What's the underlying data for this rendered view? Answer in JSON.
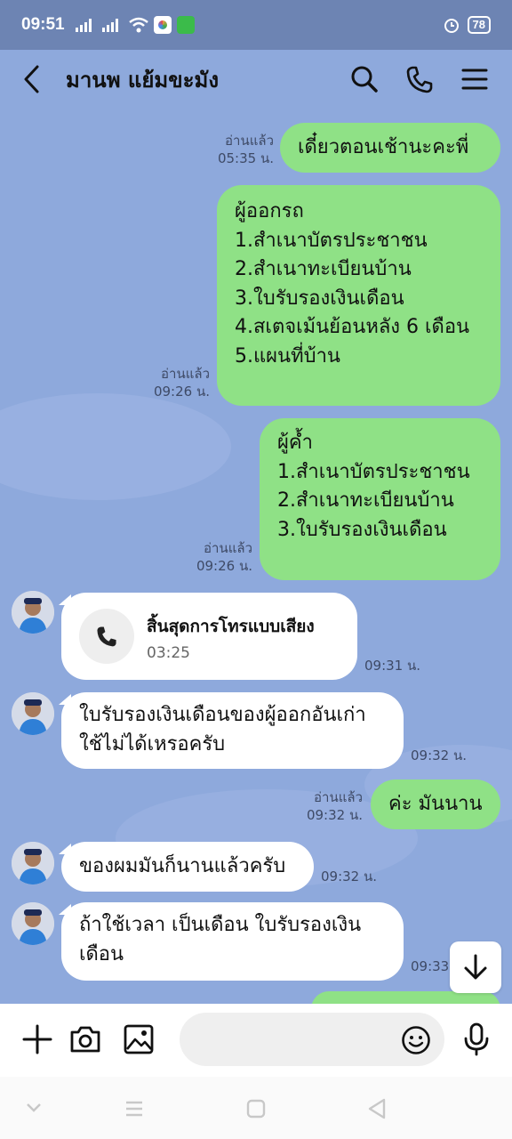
{
  "status": {
    "time": "09:51",
    "battery": "78"
  },
  "header": {
    "title": "มานพ แย้มขะมัง"
  },
  "messages": {
    "m1": {
      "text": "เดี๋ยวตอนเช้านะคะพี่",
      "read": "อ่านแล้ว",
      "time": "05:35 น."
    },
    "m2": {
      "text": "ผู้ออกรถ\n1.สำเนาบัตรประชาชน\n2.สำเนาทะเบียนบ้าน\n3.ใบรับรองเงินเดือน\n4.สเตจเม้นย้อนหลัง 6 เดือน\n5.แผนที่บ้าน",
      "read": "อ่านแล้ว",
      "time": "09:26 น."
    },
    "m3": {
      "text": "ผู้ค้ำ\n1.สำเนาบัตรประชาชน\n2.สำเนาทะเบียนบ้าน\n3.ใบรับรองเงินเดือน",
      "read": "อ่านแล้ว",
      "time": "09:26 น."
    },
    "m4": {
      "call_title": "สิ้นสุดการโทรแบบเสียง",
      "duration": "03:25",
      "time": "09:31 น."
    },
    "m5": {
      "text": "ใบรับรองเงินเดือนของผู้ออกอันเก่า\nใช้ไม่ได้เหรอครับ",
      "time": "09:32 น."
    },
    "m6": {
      "text": "ค่ะ มันนาน",
      "read": "อ่านแล้ว",
      "time": "09:32 น."
    },
    "m7": {
      "text": "ของผมมันก็นานแล้วครับ",
      "time": "09:32 น."
    },
    "m8": {
      "text": "ถ้าใช้เวลา เป็นเดือน ใบรับรองเงิน\nเดือน",
      "time": "09:33"
    }
  },
  "colors": {
    "chat_bg": "#8ea9dc",
    "outgoing": "#8fe186",
    "incoming": "#ffffff",
    "status_bg": "#6d84b3"
  },
  "icons": [
    "back-icon",
    "search-icon",
    "phone-icon",
    "menu-icon",
    "plus-icon",
    "camera-icon",
    "image-icon",
    "emoji-icon",
    "mic-icon",
    "arrow-down-icon"
  ]
}
